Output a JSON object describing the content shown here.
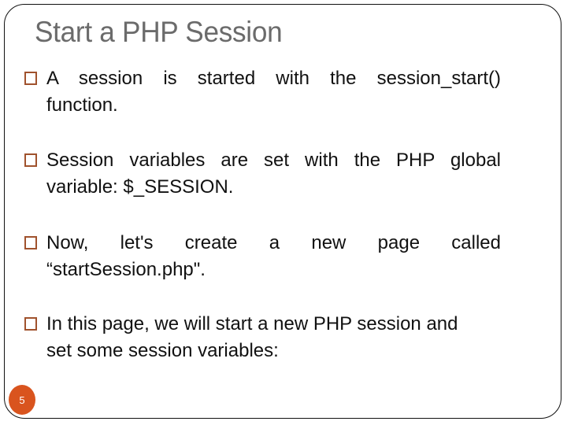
{
  "slide": {
    "title": "Start a PHP Session",
    "page_number": "5",
    "bullet_icon": "square-outline-bullet",
    "accent_color": "#d9541e",
    "bullets": [
      {
        "line1": "A session is started with the session_start()",
        "line2": "function."
      },
      {
        "line1": "Session variables are set with the PHP global",
        "line2": "variable: $_SESSION."
      },
      {
        "line1": "Now, let's create a new page called",
        "line2": "“startSession.php\"."
      },
      {
        "line1": "In this page, we will start a new PHP session and",
        "line2": "set some session variables:"
      }
    ]
  }
}
